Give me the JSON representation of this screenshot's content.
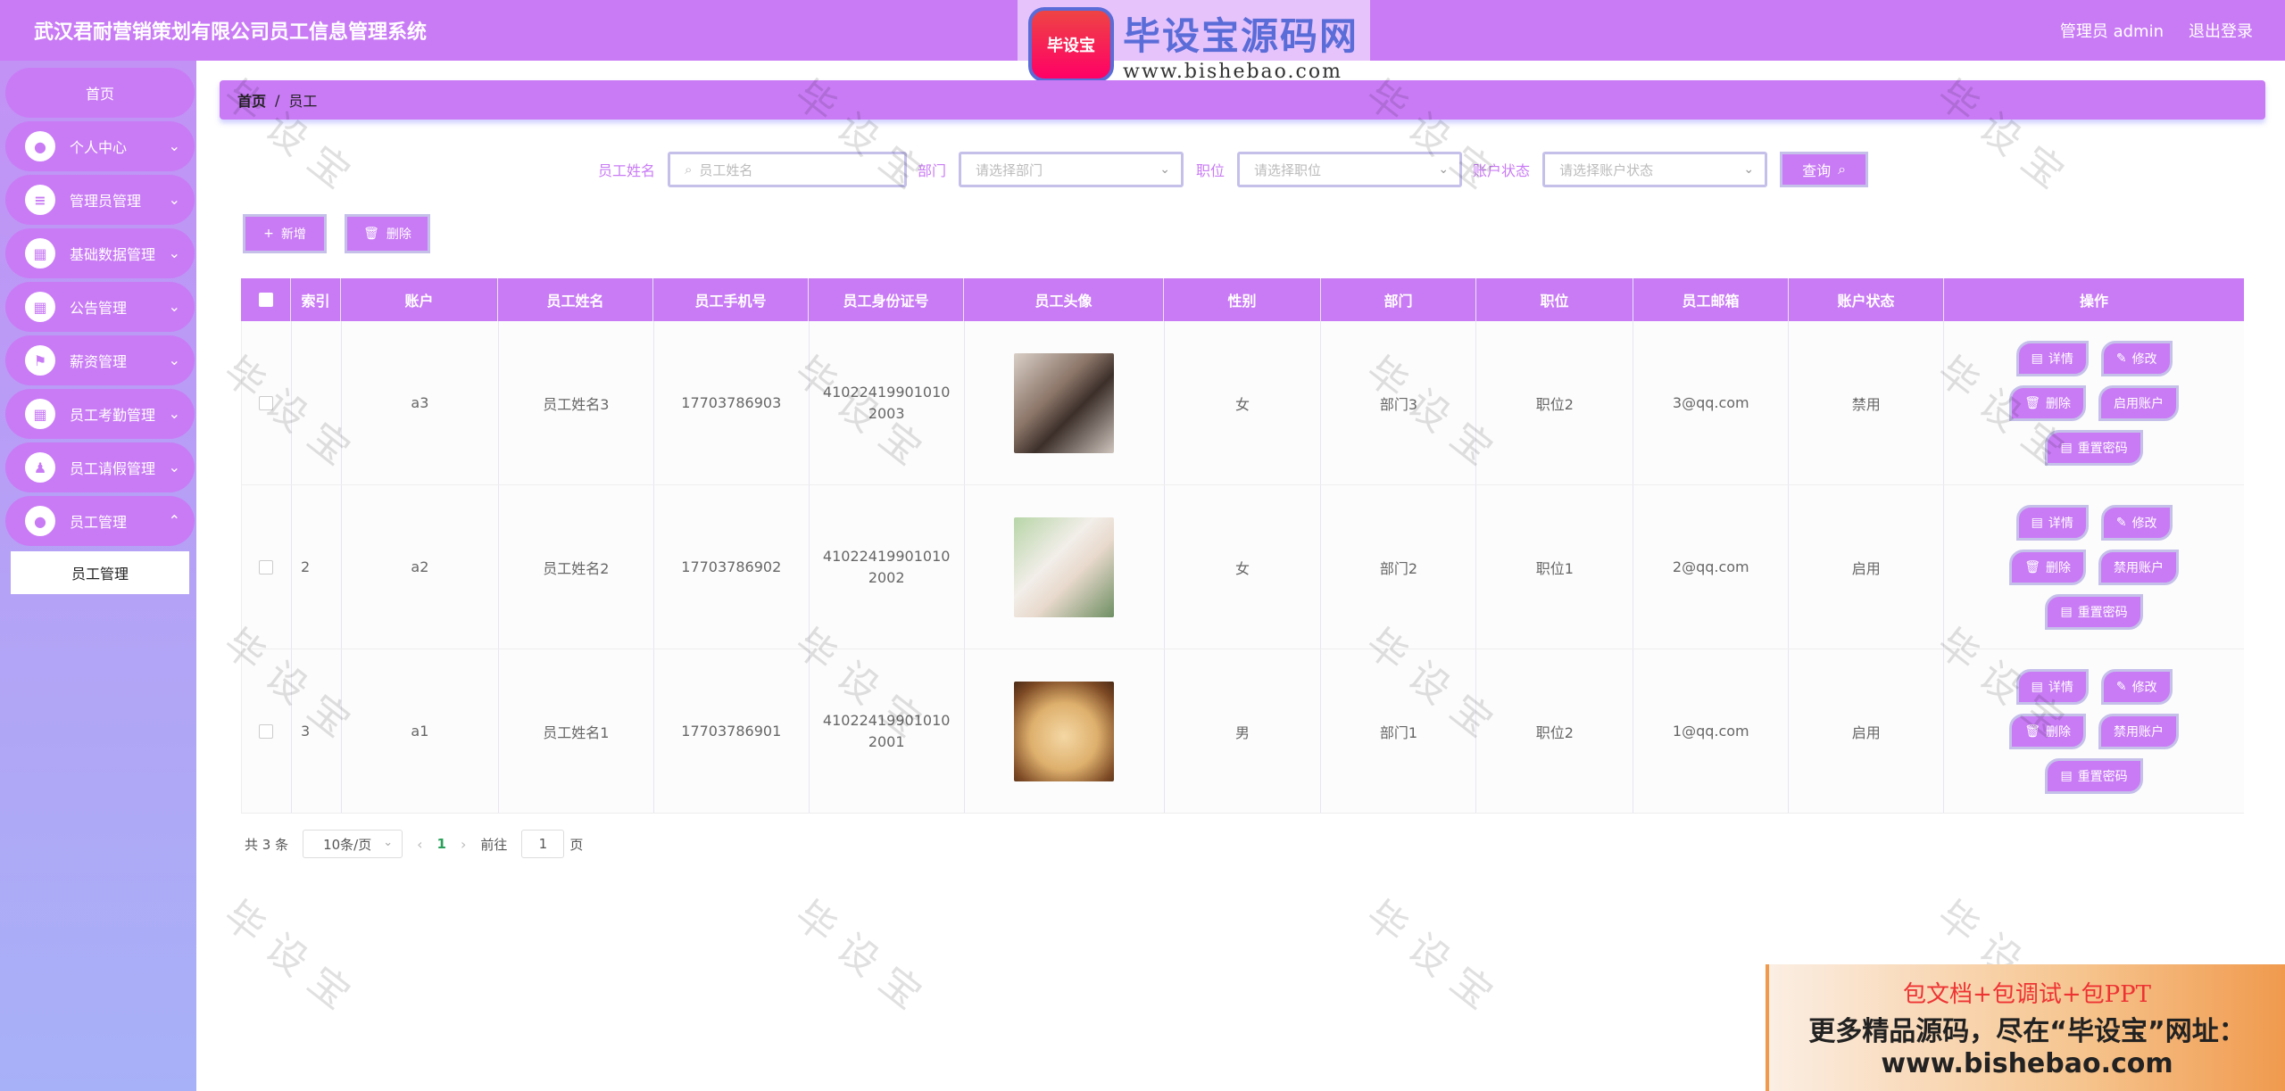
{
  "app": {
    "title": "武汉君耐营销策划有限公司员工信息管理系统",
    "user_label": "管理员 admin",
    "logout_label": "退出登录"
  },
  "logo": {
    "badge": "毕设宝",
    "main": "毕设宝源码网",
    "url": "www.bishebao.com"
  },
  "sidebar": {
    "home": "首页",
    "items": [
      {
        "label": "个人中心",
        "icon": "user-icon"
      },
      {
        "label": "管理员管理",
        "icon": "list-icon"
      },
      {
        "label": "基础数据管理",
        "icon": "grid-icon"
      },
      {
        "label": "公告管理",
        "icon": "grid-icon"
      },
      {
        "label": "薪资管理",
        "icon": "flag-icon"
      },
      {
        "label": "员工考勤管理",
        "icon": "grid-icon"
      },
      {
        "label": "员工请假管理",
        "icon": "person-icon"
      },
      {
        "label": "员工管理",
        "icon": "user-icon"
      }
    ],
    "sub_item": "员工管理"
  },
  "breadcrumb": {
    "home": "首页",
    "sep": "/",
    "current": "员工"
  },
  "search": {
    "name_label": "员工姓名",
    "name_placeholder": "员工姓名",
    "dept_label": "部门",
    "dept_placeholder": "请选择部门",
    "position_label": "职位",
    "position_placeholder": "请选择职位",
    "status_label": "账户状态",
    "status_placeholder": "请选择账户状态",
    "button": "查询"
  },
  "actions": {
    "add": "新增",
    "delete": "删除"
  },
  "table": {
    "headers": [
      "索引",
      "账户",
      "员工姓名",
      "员工手机号",
      "员工身份证号",
      "员工头像",
      "性别",
      "部门",
      "职位",
      "员工邮箱",
      "账户状态",
      "操作"
    ],
    "rows": [
      {
        "index": "",
        "account": "a3",
        "name": "员工姓名3",
        "phone": "17703786903",
        "id_card": "410224199010102003",
        "avatar": "avatar-photo-1",
        "gender": "女",
        "dept": "部门3",
        "position": "职位2",
        "email": "3@qq.com",
        "status": "禁用",
        "toggle_label": "启用账户"
      },
      {
        "index": "2",
        "account": "a2",
        "name": "员工姓名2",
        "phone": "17703786902",
        "id_card": "410224199010102002",
        "avatar": "avatar-photo-2",
        "gender": "女",
        "dept": "部门2",
        "position": "职位1",
        "email": "2@qq.com",
        "status": "启用",
        "toggle_label": "禁用账户"
      },
      {
        "index": "3",
        "account": "a1",
        "name": "员工姓名1",
        "phone": "17703786901",
        "id_card": "410224199010102001",
        "avatar": "avatar-photo-3",
        "gender": "男",
        "dept": "部门1",
        "position": "职位2",
        "email": "1@qq.com",
        "status": "启用",
        "toggle_label": "禁用账户"
      }
    ],
    "op_detail": "详情",
    "op_edit": "修改",
    "op_delete": "删除",
    "op_reset": "重置密码"
  },
  "pager": {
    "total": "共 3 条",
    "page_size": "10条/页",
    "current": "1",
    "goto_label": "前往",
    "goto_value": "1",
    "page_suffix": "页"
  },
  "watermark": "毕设宝",
  "ad": {
    "line1": "包文档+包调试+包PPT",
    "line2": "更多精品源码，尽在“毕设宝”网址：",
    "line3": "www.bishebao.com"
  },
  "colors": {
    "accent": "#c97bf5",
    "sidebar_bottom": "#a7b1f7",
    "border": "#c5c0ea"
  }
}
